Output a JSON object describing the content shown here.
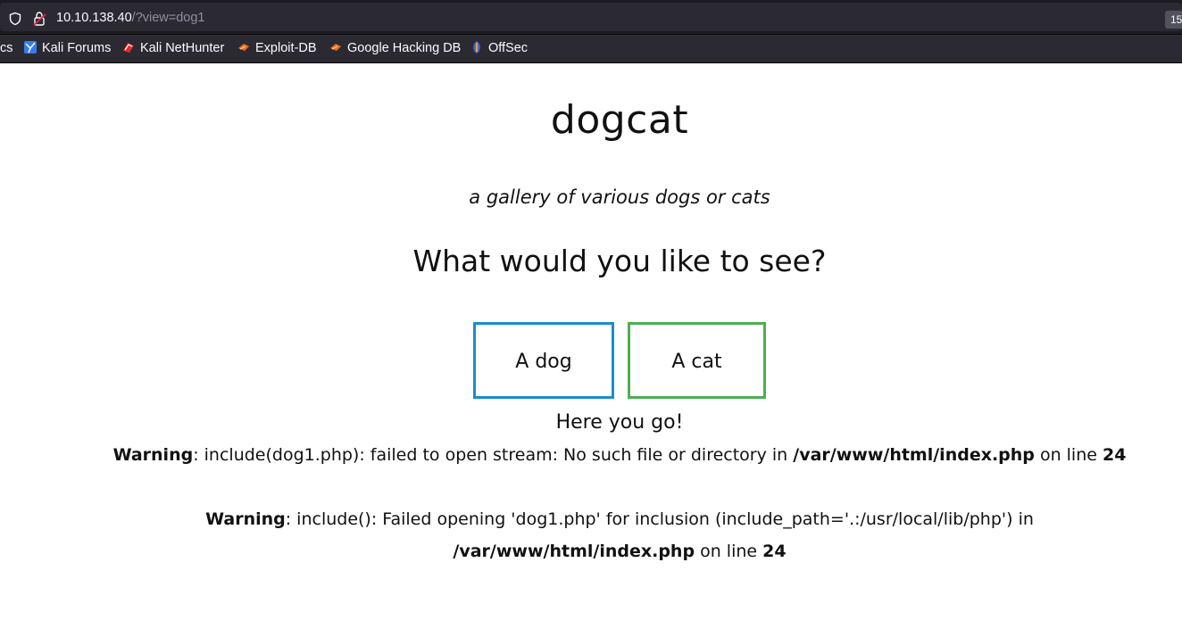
{
  "browser": {
    "url_host": "10.10.138.40",
    "url_path": "/?view=dog1",
    "zoom_badge": "15",
    "bookmarks": [
      {
        "label": "cs",
        "icon": "none"
      },
      {
        "label": "Kali Forums",
        "icon": "kali-forums-icon"
      },
      {
        "label": "Kali NetHunter",
        "icon": "kali-nethunter-icon"
      },
      {
        "label": "Exploit-DB",
        "icon": "exploit-db-icon"
      },
      {
        "label": "Google Hacking DB",
        "icon": "ghdb-icon"
      },
      {
        "label": "OffSec",
        "icon": "offsec-icon"
      }
    ]
  },
  "page": {
    "title": "dogcat",
    "subtitle": "a gallery of various dogs or cats",
    "question": "What would you like to see?",
    "buttons": {
      "dog": "A dog",
      "cat": "A cat"
    },
    "result_text": "Here you go!",
    "warnings": [
      {
        "label": "Warning",
        "message": ": include(dog1.php): failed to open stream: No such file or directory in ",
        "file": "/var/www/html/index.php",
        "on_line": " on line ",
        "line": "24"
      },
      {
        "label": "Warning",
        "message": ": include(): Failed opening 'dog1.php' for inclusion (include_path='.:/usr/local/lib/php') in ",
        "file": "/var/www/html/index.php",
        "on_line": " on line ",
        "line": "24"
      }
    ]
  },
  "colors": {
    "dog_border": "#1a8ec9",
    "cat_border": "#4caf50",
    "chrome_bg": "#2b2a33"
  }
}
